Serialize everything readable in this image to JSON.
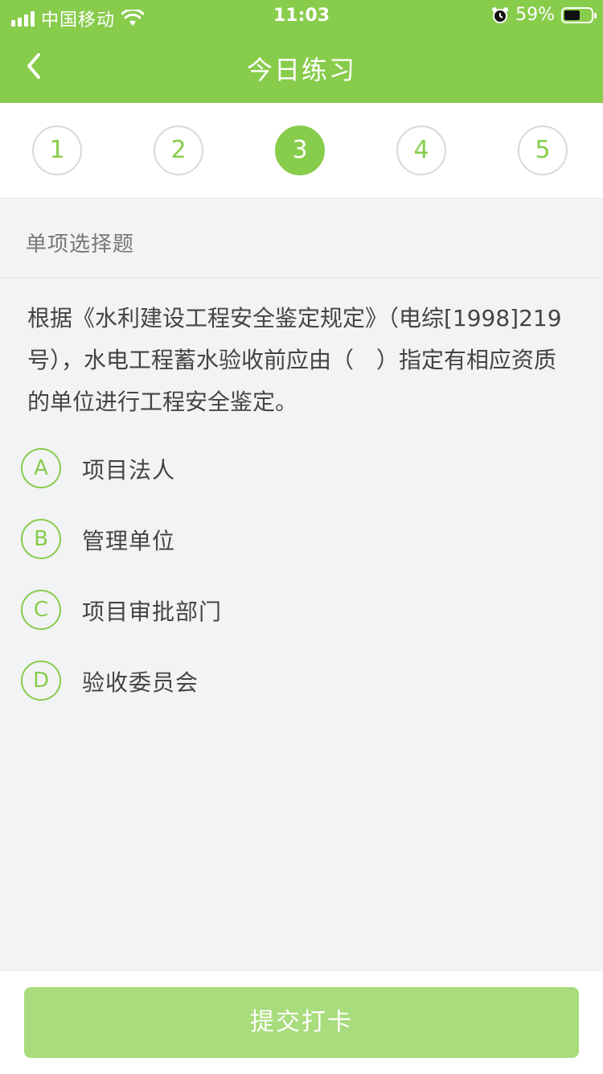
{
  "status_bar": {
    "carrier": "中国移动",
    "time": "11:03",
    "battery": "59%",
    "battery_level": 0.59
  },
  "nav": {
    "title": "今日练习",
    "back_icon": "chevron-left-icon"
  },
  "steps": [
    {
      "label": "1",
      "active": false
    },
    {
      "label": "2",
      "active": false
    },
    {
      "label": "3",
      "active": true
    },
    {
      "label": "4",
      "active": false
    },
    {
      "label": "5",
      "active": false
    }
  ],
  "question": {
    "type": "单项选择题",
    "text": "根据《水利建设工程安全鉴定规定》（电综[1998]219号），水电工程蓄水验收前应由（　）指定有相应资质的单位进行工程安全鉴定。",
    "options": [
      {
        "letter": "A",
        "label": "项目法人"
      },
      {
        "letter": "B",
        "label": "管理单位"
      },
      {
        "letter": "C",
        "label": "项目审批部门"
      },
      {
        "letter": "D",
        "label": "验收委员会"
      }
    ]
  },
  "footer": {
    "submit_label": "提交打卡"
  },
  "colors": {
    "brand_green": "#88cc4c",
    "submit_disabled": "#a8dc7c",
    "background": "#f2f3f5"
  }
}
